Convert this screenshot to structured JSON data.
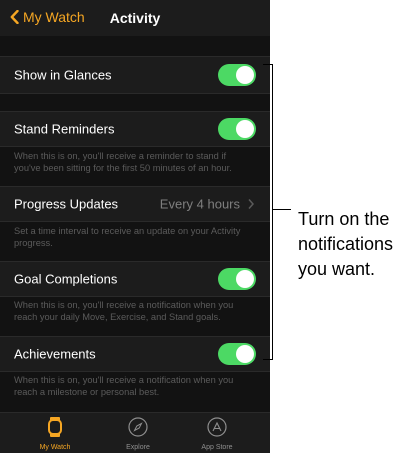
{
  "navbar": {
    "back_label": "My Watch",
    "title": "Activity"
  },
  "settings": [
    {
      "label": "Show in Glances",
      "type": "toggle",
      "on": true
    },
    {
      "label": "Stand Reminders",
      "type": "toggle",
      "on": true,
      "description": "When this is on, you'll receive a reminder to stand if you've been sitting for the first 50 minutes of an hour."
    },
    {
      "label": "Progress Updates",
      "type": "disclosure",
      "value": "Every 4 hours",
      "description": "Set a time interval to receive an update on your Activity progress."
    },
    {
      "label": "Goal Completions",
      "type": "toggle",
      "on": true,
      "description": "When this is on, you'll receive a notification when you reach your daily Move, Exercise, and Stand goals."
    },
    {
      "label": "Achievements",
      "type": "toggle",
      "on": true,
      "description": "When this is on, you'll receive a notification when you reach a milestone or personal best."
    }
  ],
  "tabbar": {
    "tabs": [
      {
        "label": "My Watch",
        "icon": "watch-icon",
        "active": true
      },
      {
        "label": "Explore",
        "icon": "compass-icon",
        "active": false
      },
      {
        "label": "App Store",
        "icon": "app-store-icon",
        "active": false
      }
    ]
  },
  "callout": {
    "lines": [
      "Turn on the",
      "notifications",
      "you want."
    ]
  },
  "colors": {
    "accent": "#f5a623",
    "toggle_on": "#4cd964",
    "background": "#121212",
    "cell": "#1c1c1c"
  }
}
